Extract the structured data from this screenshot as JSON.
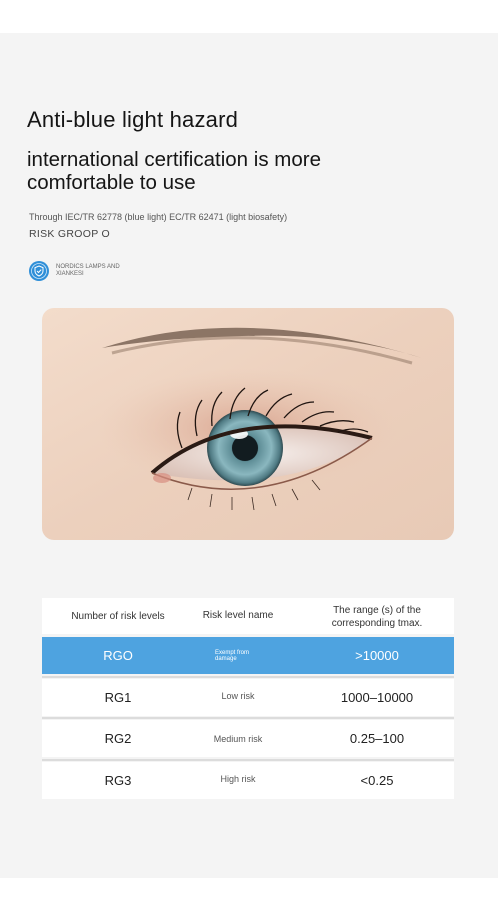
{
  "heading": "Anti-blue light hazard",
  "subheading_lines": [
    "international certification is more",
    "comfortable to use"
  ],
  "certification_text": "Through IEC/TR 62778 (blue light) EC/TR 62471 (light biosafety)",
  "risk_group_text": "RISK GROOP O",
  "badge": {
    "icon": "shield-check-icon",
    "lines": [
      "NORDICS LAMPS AND",
      "XIANKESI"
    ]
  },
  "table": {
    "headers": {
      "levels": "Number of risk levels",
      "name": "Risk level name",
      "range_line1": "The range (s) of the",
      "range_line2": "corresponding tmax."
    },
    "rows": [
      {
        "level": "RGO",
        "name_line1": "Exempt from",
        "name_line2": "damage",
        "range": ">10000",
        "highlight": true
      },
      {
        "level": "RG1",
        "name": "Low risk",
        "range": "1000–10000"
      },
      {
        "level": "RG2",
        "name": "Medium risk",
        "range": "0.25–100"
      },
      {
        "level": "RG3",
        "name": "High risk",
        "range": "<0.25"
      }
    ]
  },
  "colors": {
    "accent": "#4ea3e0",
    "badge": "#2f8fd8",
    "panel": "#f4f4f4"
  }
}
